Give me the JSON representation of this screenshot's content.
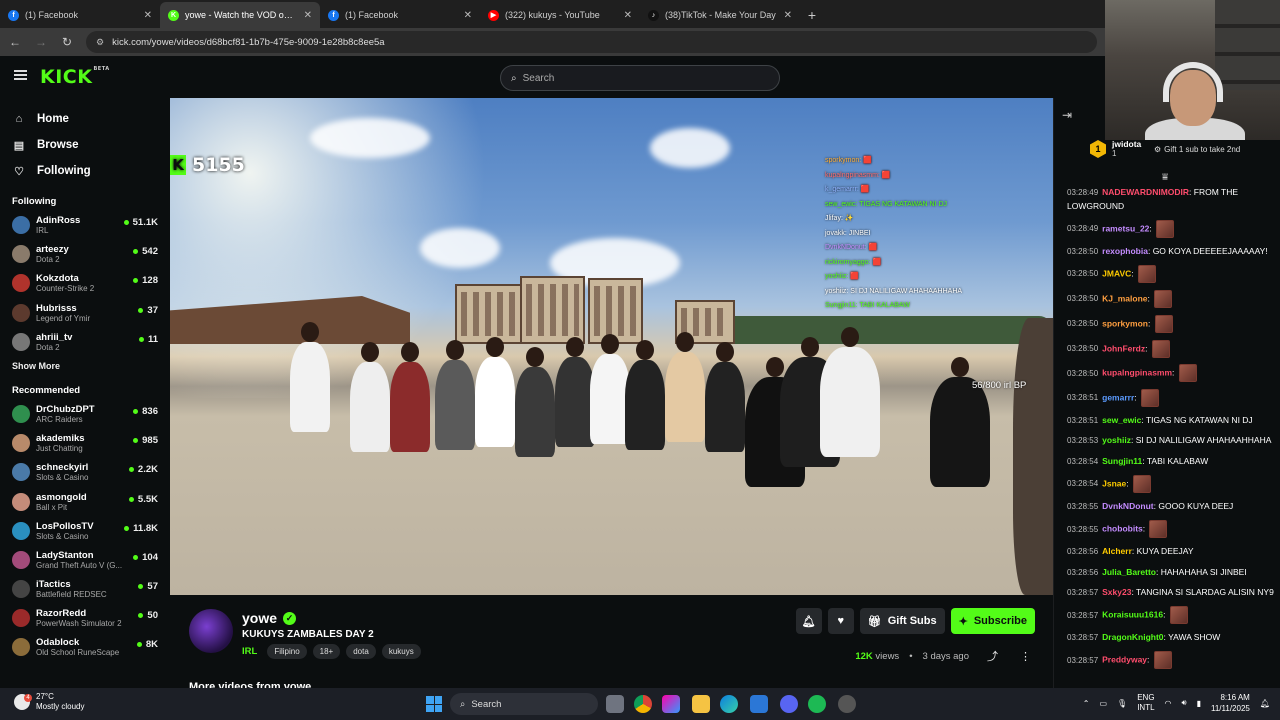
{
  "browser": {
    "tabs": [
      {
        "title": "(1) Facebook",
        "fav_color": "#1877f2",
        "fav_glyph": "f",
        "active": false
      },
      {
        "title": "yowe - Watch the VOD on Kick",
        "fav_color": "#53fc18",
        "fav_glyph": "K",
        "active": true
      },
      {
        "title": "(1) Facebook",
        "fav_color": "#1877f2",
        "fav_glyph": "f",
        "active": false
      },
      {
        "title": "(322) kukuys - YouTube",
        "fav_color": "#ff0000",
        "fav_glyph": "▶",
        "active": false
      },
      {
        "title": "(38)TikTok - Make Your Day",
        "fav_color": "#111111",
        "fav_glyph": "♪",
        "active": false
      }
    ],
    "url": "kick.com/yowe/videos/d68bcf81-1b7b-475e-9009-1e28b8c8ee5a"
  },
  "header": {
    "logo": "KICK",
    "logo_badge": "BETA",
    "search_placeholder": "Search"
  },
  "sidebar": {
    "nav": [
      {
        "label": "Home",
        "icon": "home-icon",
        "glyph": "⌂"
      },
      {
        "label": "Browse",
        "icon": "browse-icon",
        "glyph": "▤"
      },
      {
        "label": "Following",
        "icon": "heart-icon",
        "glyph": "♡"
      }
    ],
    "following_heading": "Following",
    "following": [
      {
        "name": "AdinRoss",
        "category": "IRL",
        "viewers": "51.1K",
        "color": "#3b6ea5"
      },
      {
        "name": "arteezy",
        "category": "Dota 2",
        "viewers": "542",
        "color": "#8a7b6b"
      },
      {
        "name": "Kokzdota",
        "category": "Counter-Strike 2",
        "viewers": "128",
        "color": "#b0332c"
      },
      {
        "name": "Hubrisss",
        "category": "Legend of Ymir",
        "viewers": "37",
        "color": "#5c3a2e"
      },
      {
        "name": "ahriii_tv",
        "category": "Dota 2",
        "viewers": "11",
        "color": "#777777"
      }
    ],
    "show_more": "Show More",
    "recommended_heading": "Recommended",
    "recommended": [
      {
        "name": "DrChubzDPT",
        "category": "ARC Raiders",
        "viewers": "836",
        "color": "#2f8f4e"
      },
      {
        "name": "akademiks",
        "category": "Just Chatting",
        "viewers": "985",
        "color": "#b88a6a"
      },
      {
        "name": "schneckyirl",
        "category": "Slots & Casino",
        "viewers": "2.2K",
        "color": "#4a7aa8"
      },
      {
        "name": "asmongold",
        "category": "Ball x Pit",
        "viewers": "5.5K",
        "color": "#c48c7a"
      },
      {
        "name": "LosPollosTV",
        "category": "Slots & Casino",
        "viewers": "11.8K",
        "color": "#2a8fbf"
      },
      {
        "name": "LadyStanton",
        "category": "Grand Theft Auto V (G...",
        "viewers": "104",
        "color": "#a34b7a"
      },
      {
        "name": "iTactics",
        "category": "Battlefield REDSEC",
        "viewers": "57",
        "color": "#444444"
      },
      {
        "name": "RazorRedd",
        "category": "PowerWash Simulator 2",
        "viewers": "50",
        "color": "#9a2a2a"
      },
      {
        "name": "Odablock",
        "category": "Old School RuneScape",
        "viewers": "8K",
        "color": "#8b6c3a"
      }
    ]
  },
  "video": {
    "sub_count": "5155",
    "sub_badge": "K",
    "bp_text": "56/800 irl BP",
    "overlay_chat": [
      {
        "text": "sporkymon: 🟥",
        "color": "#ffb13b"
      },
      {
        "text": "kupalngpinasmm: 🟥",
        "color": "#ff6b6b"
      },
      {
        "text": "k_gemarrr: 🟥",
        "color": "#8fb3ff"
      },
      {
        "text": "sew_ewic: TIGAS NG KATAWAN NI DJ",
        "color": "#53fc18"
      },
      {
        "text": "Jlifay: ✨",
        "color": "#ffffff"
      },
      {
        "text": "jovakk: JINBEI",
        "color": "#ffffff"
      },
      {
        "text": "DvnkNDonut: 🟥",
        "color": "#c48cff"
      },
      {
        "text": "rickiromyaggo: 🟥",
        "color": "#53fc18"
      },
      {
        "text": "yoshiiz: 🟥",
        "color": "#53fc18"
      },
      {
        "text": "yoshiiz: SI DJ NALILIGAW AHAHAAHHAHA",
        "color": "#ffffff"
      },
      {
        "text": "Sungjin11: TABI KALABAW",
        "color": "#53fc18"
      }
    ]
  },
  "info": {
    "channel": "yowe",
    "title": "KUKUYS ZAMBALES DAY 2",
    "category": "IRL",
    "tags": [
      "Filipino",
      "18+",
      "dota",
      "kukuys"
    ],
    "gift_label": "Gift Subs",
    "subscribe_label": "Subscribe",
    "views": "12K",
    "views_label": "views",
    "age": "3 days ago",
    "more_videos": "More videos from yowe"
  },
  "chat": {
    "top_gifter": "jwidota",
    "top_gifter_count": "1",
    "gift_prompt": "Gift 1 sub to take 2nd",
    "messages": [
      {
        "ts": "03:28:49",
        "user": "NADEWARDNIMODIR",
        "color": "#ff4d6d",
        "text": "FROM THE LOWGROUND",
        "emote": false
      },
      {
        "ts": "03:28:49",
        "user": "rametsu_22",
        "color": "#c48cff",
        "text": "",
        "emote": true
      },
      {
        "ts": "03:28:50",
        "user": "rexophobia",
        "color": "#c48cff",
        "text": "GO KOYA DEEEEEJAAAAAY!",
        "emote": false
      },
      {
        "ts": "03:28:50",
        "user": "JMAVC",
        "color": "#ffcc00",
        "text": "",
        "emote": true
      },
      {
        "ts": "03:28:50",
        "user": "KJ_malone",
        "color": "#ff9f40",
        "text": "",
        "emote": true
      },
      {
        "ts": "03:28:50",
        "user": "sporkymon",
        "color": "#ff9f40",
        "text": "",
        "emote": true
      },
      {
        "ts": "03:28:50",
        "user": "JohnFerdz",
        "color": "#ff4d6d",
        "text": "",
        "emote": true
      },
      {
        "ts": "03:28:50",
        "user": "kupalngpinasmm",
        "color": "#ff4d6d",
        "text": "",
        "emote": true
      },
      {
        "ts": "03:28:51",
        "user": "gemarrr",
        "color": "#5b9bff",
        "text": "",
        "emote": true
      },
      {
        "ts": "03:28:51",
        "user": "sew_ewic",
        "color": "#53fc18",
        "text": "TIGAS NG KATAWAN NI DJ",
        "emote": false
      },
      {
        "ts": "03:28:53",
        "user": "yoshiiz",
        "color": "#53fc18",
        "text": "SI DJ NALILIGAW AHAHAAHHAHA",
        "emote": false
      },
      {
        "ts": "03:28:54",
        "user": "Sungjin11",
        "color": "#53fc18",
        "text": "TABI KALABAW",
        "emote": false
      },
      {
        "ts": "03:28:54",
        "user": "Jsnae",
        "color": "#ffcc00",
        "text": "",
        "emote": true
      },
      {
        "ts": "03:28:55",
        "user": "DvnkNDonut",
        "color": "#c48cff",
        "text": "GOOO KUYA DEEJ",
        "emote": false
      },
      {
        "ts": "03:28:55",
        "user": "chobobits",
        "color": "#c48cff",
        "text": "",
        "emote": true
      },
      {
        "ts": "03:28:56",
        "user": "Alcherr",
        "color": "#ffcc00",
        "text": "KUYA DEEJAY",
        "emote": false
      },
      {
        "ts": "03:28:56",
        "user": "Julia_Baretto",
        "color": "#53fc18",
        "text": "HAHAHAHA SI JINBEI",
        "emote": false
      },
      {
        "ts": "03:28:57",
        "user": "Sxky23",
        "color": "#ff4d6d",
        "text": "TANGINA SI SLARDAG ALISIN NY9",
        "emote": false
      },
      {
        "ts": "03:28:57",
        "user": "Koraisuuu1616",
        "color": "#53fc18",
        "text": "",
        "emote": true
      },
      {
        "ts": "03:28:57",
        "user": "DragonKnight0",
        "color": "#53fc18",
        "text": "YAWA SHOW",
        "emote": false
      },
      {
        "ts": "03:28:57",
        "user": "Preddyway",
        "color": "#ff4d6d",
        "text": "",
        "emote": true
      }
    ]
  },
  "taskbar": {
    "temp": "27°C",
    "weather": "Mostly cloudy",
    "weather_badge": "4",
    "search": "Search",
    "lang1": "ENG",
    "lang2": "INTL",
    "time": "8:16 AM",
    "date": "11/11/2025"
  },
  "colors": {
    "accent": "#53fc18",
    "bg": "#0b0e0f"
  }
}
